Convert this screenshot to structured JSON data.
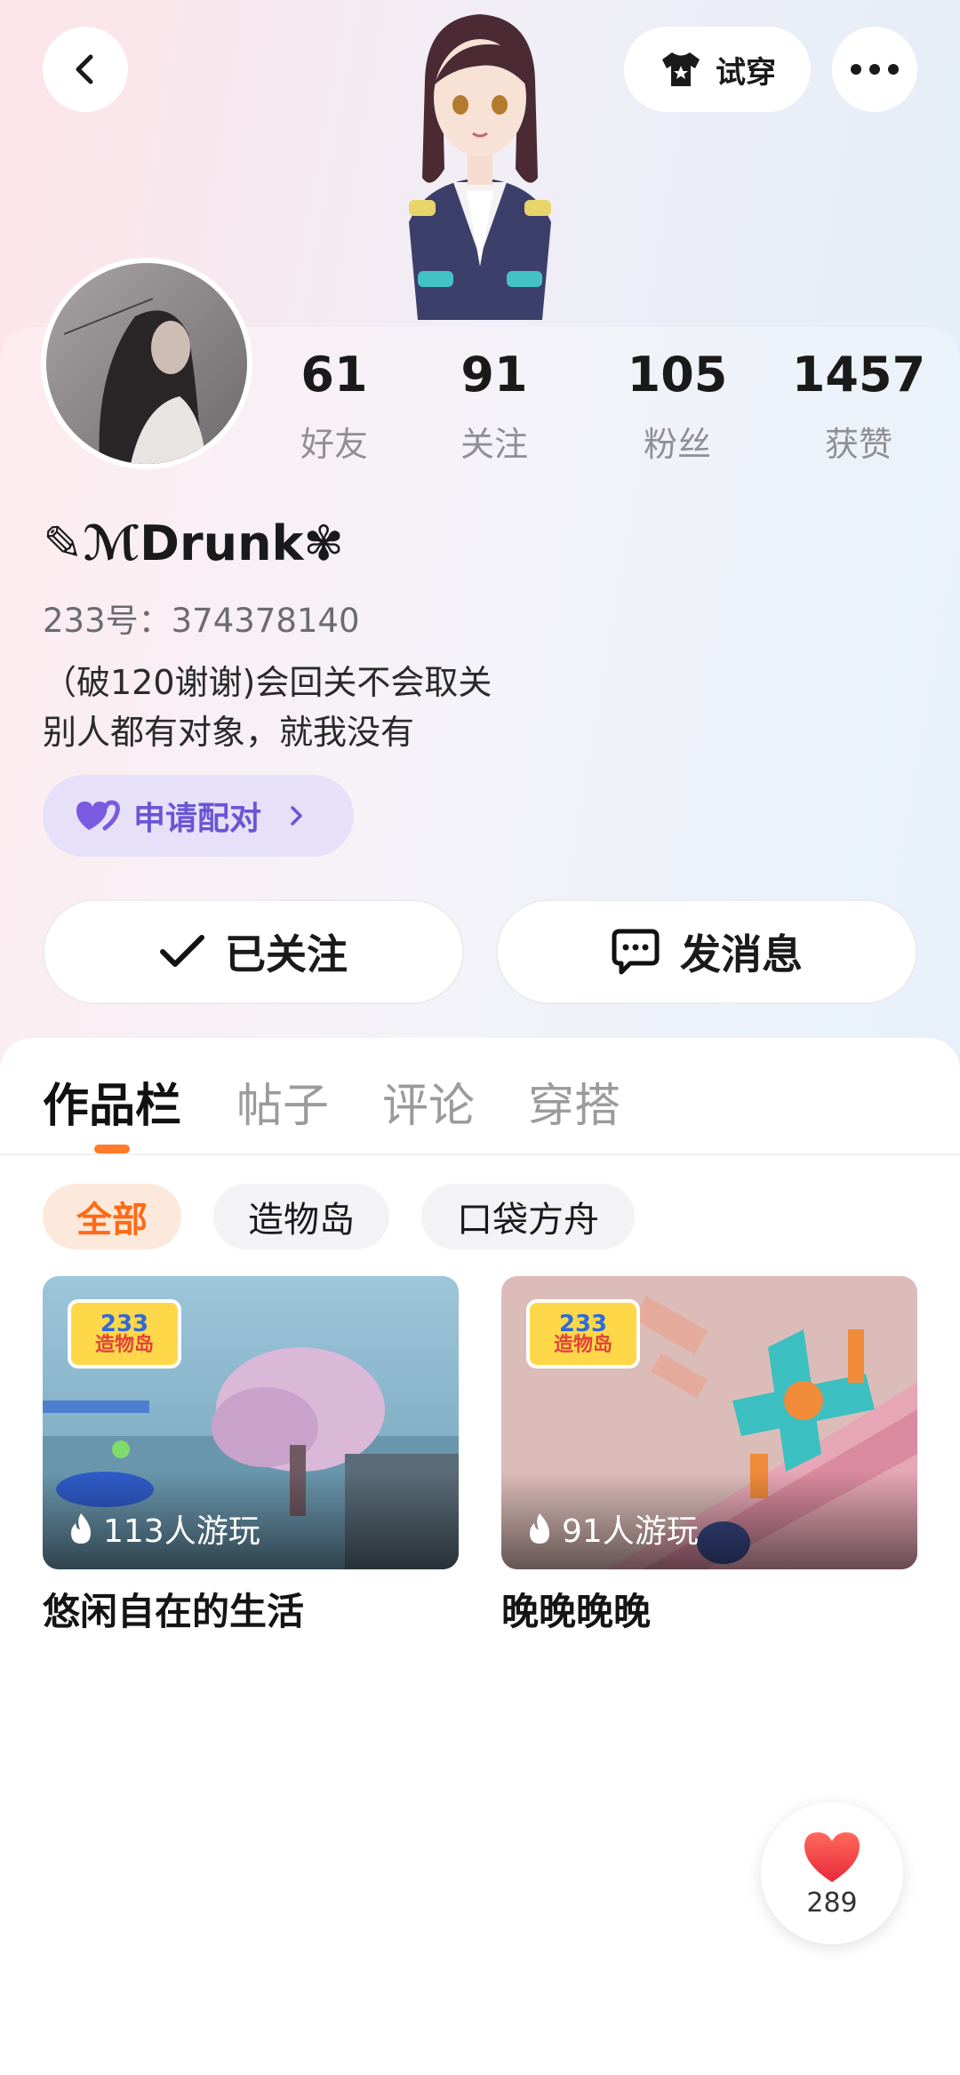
{
  "header": {
    "tryon_label": "试穿"
  },
  "profile": {
    "username": "✎ℳDrunk✾",
    "uid": "233号：374378140",
    "bio_line1": "（破120谢谢)会回关不会取关",
    "bio_line2": "别人都有对象，就我没有",
    "pair_label": "申请配对"
  },
  "stats": [
    {
      "value": "61",
      "label": "好友"
    },
    {
      "value": "91",
      "label": "关注"
    },
    {
      "value": "105",
      "label": "粉丝"
    },
    {
      "value": "1457",
      "label": "获赞"
    }
  ],
  "actions": {
    "follow_label": "已关注",
    "message_label": "发消息"
  },
  "tabs": [
    {
      "label": "作品栏"
    },
    {
      "label": "帖子"
    },
    {
      "label": "评论"
    },
    {
      "label": "穿搭"
    }
  ],
  "filters": [
    {
      "label": "全部"
    },
    {
      "label": "造物岛"
    },
    {
      "label": "口袋方舟"
    }
  ],
  "works": [
    {
      "title": "悠闲自在的生活",
      "plays": "113人游玩",
      "badge_top": "233",
      "badge_bottom": "造物岛"
    },
    {
      "title": "晚晚晚晚",
      "plays": "91人游玩",
      "badge_top": "233",
      "badge_bottom": "造物岛"
    }
  ],
  "like_fab": {
    "count": "289"
  },
  "colors": {
    "accent_orange": "#ff7a29",
    "pair_purple": "#6a55d6",
    "like_red": "#f0483c"
  }
}
